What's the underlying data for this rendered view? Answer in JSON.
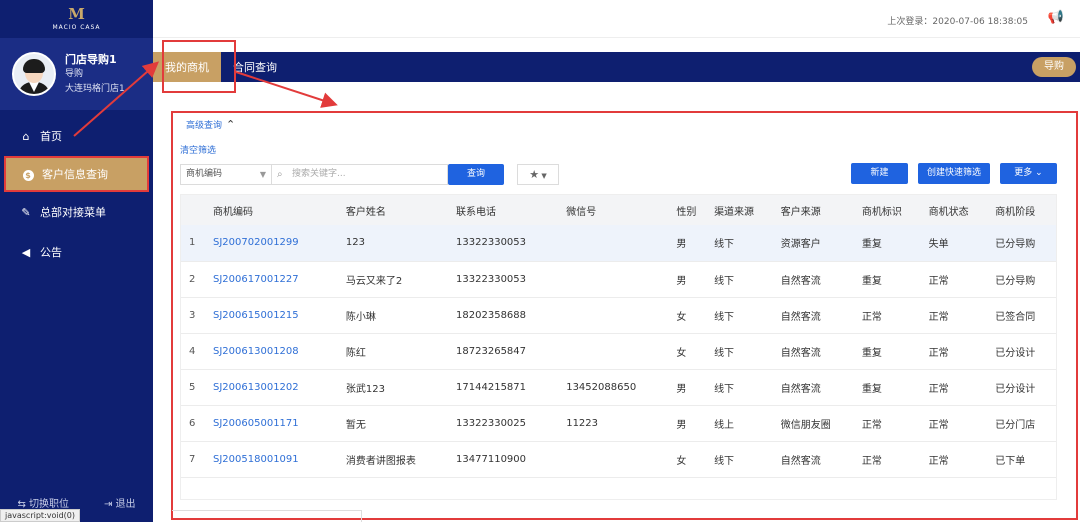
{
  "brand": {
    "mark": "M",
    "name": "MACIO CASA"
  },
  "user": {
    "name": "门店导购1",
    "role": "导购",
    "store": "大连玛格门店1"
  },
  "sidebar": {
    "items": [
      {
        "label": "首页",
        "icon": "home-icon"
      },
      {
        "label": "客户信息查询",
        "icon": "dollar-circle-icon"
      },
      {
        "label": "总部对接菜单",
        "icon": "edit-icon"
      },
      {
        "label": "公告",
        "icon": "megaphone-icon"
      }
    ],
    "footer": {
      "switch_label": "切换职位",
      "logout_label": "退出"
    }
  },
  "header": {
    "last_login": "上次登录：2020-07-06 18:38:05"
  },
  "tabs": [
    {
      "label": "我的商机"
    },
    {
      "label": "合同查询"
    }
  ],
  "role_pill": "导购",
  "filters": {
    "advanced_label": "高级查询",
    "clear_label": "清空筛选",
    "field_select": "商机编码",
    "search_placeholder": "搜索关键字...",
    "query_button": "查询"
  },
  "actions": {
    "new_label": "新建",
    "quick_filter_label": "创建快速筛选",
    "more_label": "更多"
  },
  "table": {
    "columns": [
      "商机编码",
      "客户姓名",
      "联系电话",
      "微信号",
      "性别",
      "渠道来源",
      "客户来源",
      "商机标识",
      "商机状态",
      "商机阶段"
    ],
    "rows": [
      {
        "idx": "1",
        "code": "SJ200702001299",
        "name": "123",
        "phone": "13322330053",
        "wechat": "",
        "gender": "男",
        "channel": "线下",
        "source": "资源客户",
        "flag": "重复",
        "status": "失单",
        "stage": "已分导购"
      },
      {
        "idx": "2",
        "code": "SJ200617001227",
        "name": "马云又来了2",
        "phone": "13322330053",
        "wechat": "",
        "gender": "男",
        "channel": "线下",
        "source": "自然客流",
        "flag": "重复",
        "status": "正常",
        "stage": "已分导购"
      },
      {
        "idx": "3",
        "code": "SJ200615001215",
        "name": "陈小琳",
        "phone": "18202358688",
        "wechat": "",
        "gender": "女",
        "channel": "线下",
        "source": "自然客流",
        "flag": "正常",
        "status": "正常",
        "stage": "已签合同"
      },
      {
        "idx": "4",
        "code": "SJ200613001208",
        "name": "陈红",
        "phone": "18723265847",
        "wechat": "",
        "gender": "女",
        "channel": "线下",
        "source": "自然客流",
        "flag": "重复",
        "status": "正常",
        "stage": "已分设计"
      },
      {
        "idx": "5",
        "code": "SJ200613001202",
        "name": "张武123",
        "phone": "17144215871",
        "wechat": "13452088650",
        "gender": "男",
        "channel": "线下",
        "source": "自然客流",
        "flag": "重复",
        "status": "正常",
        "stage": "已分设计"
      },
      {
        "idx": "6",
        "code": "SJ200605001171",
        "name": "暂无",
        "phone": "13322330025",
        "wechat": "11223",
        "gender": "男",
        "channel": "线上",
        "source": "微信朋友圈",
        "flag": "正常",
        "status": "正常",
        "stage": "已分门店"
      },
      {
        "idx": "7",
        "code": "SJ200518001091",
        "name": "消费者讲图报表",
        "phone": "13477110900",
        "wechat": "",
        "gender": "女",
        "channel": "线下",
        "source": "自然客流",
        "flag": "正常",
        "status": "正常",
        "stage": "已下单"
      }
    ]
  },
  "statusbar": {
    "text": "javascript:void(0)"
  },
  "colors": {
    "navy": "#0e1f70",
    "gold": "#c8a064",
    "blue": "#1f63e0",
    "annotation_red": "#e23b3b"
  }
}
